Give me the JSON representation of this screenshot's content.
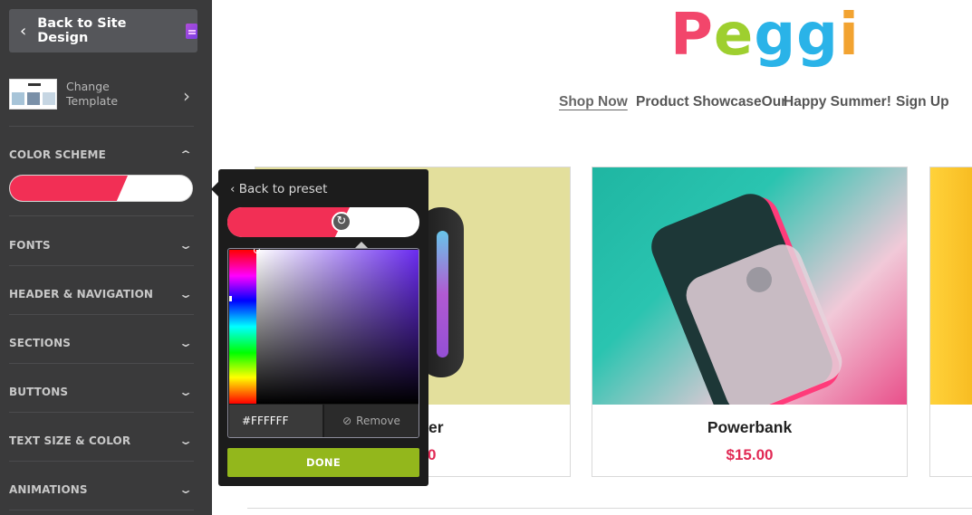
{
  "sidebar": {
    "back_label": "Back to Site Design",
    "template_label": "Change Template",
    "color_scheme_label": "COLOR SCHEME",
    "sections": [
      {
        "label": "FONTS"
      },
      {
        "label": "HEADER & NAVIGATION"
      },
      {
        "label": "SECTIONS"
      },
      {
        "label": "BUTTONS"
      },
      {
        "label": "TEXT SIZE & COLOR"
      },
      {
        "label": "ANIMATIONS"
      }
    ]
  },
  "color_popover": {
    "back_label": "Back to preset",
    "hex_value": "#FFFFFF",
    "remove_label": "Remove",
    "done_label": "DONE"
  },
  "site": {
    "logo_letters": [
      "P",
      "e",
      "g",
      "g",
      "i"
    ],
    "logo_colors": [
      "#f2466b",
      "#9ecf2f",
      "#2ab3e8",
      "#2ab3e8",
      "#f2a331"
    ],
    "nav": [
      "Shop Now",
      "Product ShowcaseOur",
      "Happy Summer!",
      "Sign Up"
    ],
    "products": [
      {
        "name": "Speaker",
        "price": "$15.00"
      },
      {
        "name": "Powerbank",
        "price": "$15.00"
      }
    ]
  },
  "colors": {
    "scheme_primary": "#f22f55",
    "scheme_secondary": "#ffffff",
    "done_button": "#93b71c",
    "price": "#e12a55"
  }
}
